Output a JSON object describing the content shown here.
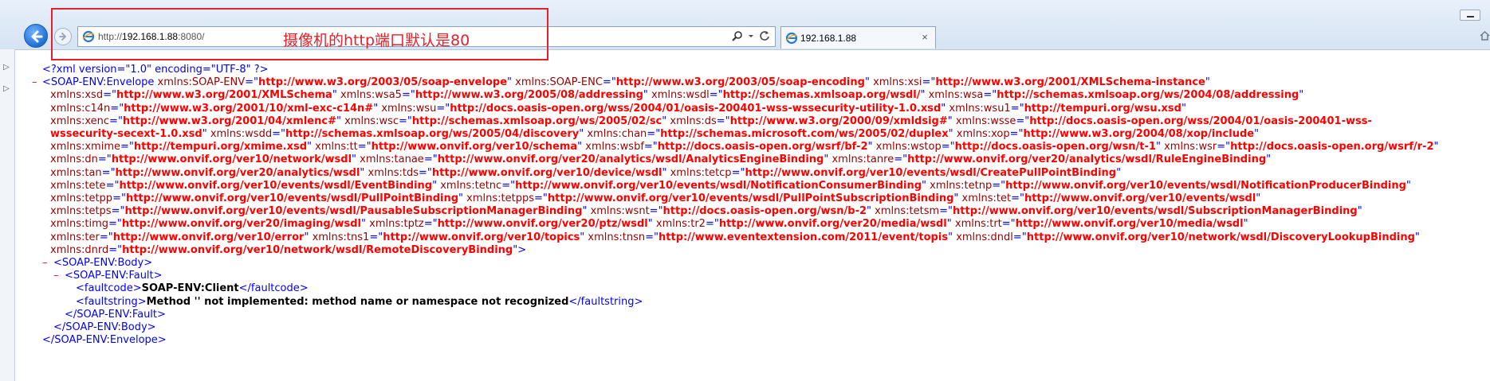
{
  "browser": {
    "url_prefix": "http://",
    "url_host": "192.168.1.88",
    "url_suffix": ":8080/",
    "tab_title": "192.168.1.88",
    "tab_close": "×"
  },
  "annotation": {
    "text": "摄像机的http端口默认是80",
    "color": "#e4202a"
  },
  "icons": {
    "back": "back-arrow-icon",
    "forward": "forward-arrow-icon",
    "page": "ie-page-icon",
    "search": "search-icon",
    "refresh": "refresh-icon"
  },
  "colors": {
    "tag": "#0000ff",
    "attr_name": "#990000",
    "attr_value": "#ff0000",
    "collapse_marker": "#e4202a"
  },
  "xml": {
    "declaration": "<?xml version=\"1.0\" encoding=\"UTF-8\" ?>",
    "collapse_marker": "–",
    "envelope_open": "<SOAP-ENV:Envelope",
    "namespace_lines": [
      [
        [
          "xmlns:SOAP-ENV",
          "http://www.w3.org/2003/05/soap-envelope"
        ],
        [
          "xmlns:SOAP-ENC",
          "http://www.w3.org/2003/05/soap-encoding"
        ],
        [
          "xmlns:xsi",
          "http://www.w3.org/2001/XMLSchema-instance"
        ]
      ],
      [
        [
          "xmlns:xsd",
          "http://www.w3.org/2001/XMLSchema"
        ],
        [
          "xmlns:wsa5",
          "http://www.w3.org/2005/08/addressing"
        ],
        [
          "xmlns:wsdl",
          "http://schemas.xmlsoap.org/wsdl/"
        ],
        [
          "xmlns:wsa",
          "http://schemas.xmlsoap.org/ws/2004/08/addressing"
        ]
      ],
      [
        [
          "xmlns:c14n",
          "http://www.w3.org/2001/10/xml-exc-c14n#"
        ],
        [
          "xmlns:wsu",
          "http://docs.oasis-open.org/wss/2004/01/oasis-200401-wss-wssecurity-utility-1.0.xsd"
        ],
        [
          "xmlns:wsu1",
          "http://tempuri.org/wsu.xsd"
        ]
      ],
      [
        [
          "xmlns:xenc",
          "http://www.w3.org/2001/04/xmlenc#"
        ],
        [
          "xmlns:wsc",
          "http://schemas.xmlsoap.org/ws/2005/02/sc"
        ],
        [
          "xmlns:ds",
          "http://www.w3.org/2000/09/xmldsig#"
        ],
        [
          "xmlns:wsse",
          "http://docs.oasis-open.org/wss/2004/01/oasis-200401-wss-"
        ]
      ],
      [
        [
          "",
          "wssecurity-secext-1.0.xsd"
        ],
        [
          "xmlns:wsdd",
          "http://schemas.xmlsoap.org/ws/2005/04/discovery"
        ],
        [
          "xmlns:chan",
          "http://schemas.microsoft.com/ws/2005/02/duplex"
        ],
        [
          "xmlns:xop",
          "http://www.w3.org/2004/08/xop/include"
        ]
      ],
      [
        [
          "xmlns:xmime",
          "http://tempuri.org/xmime.xsd"
        ],
        [
          "xmlns:tt",
          "http://www.onvif.org/ver10/schema"
        ],
        [
          "xmlns:wsbf",
          "http://docs.oasis-open.org/wsrf/bf-2"
        ],
        [
          "xmlns:wstop",
          "http://docs.oasis-open.org/wsn/t-1"
        ],
        [
          "xmlns:wsr",
          "http://docs.oasis-open.org/wsrf/r-2"
        ]
      ],
      [
        [
          "xmlns:dn",
          "http://www.onvif.org/ver10/network/wsdl"
        ],
        [
          "xmlns:tanae",
          "http://www.onvif.org/ver20/analytics/wsdl/AnalyticsEngineBinding"
        ],
        [
          "xmlns:tanre",
          "http://www.onvif.org/ver20/analytics/wsdl/RuleEngineBinding"
        ]
      ],
      [
        [
          "xmlns:tan",
          "http://www.onvif.org/ver20/analytics/wsdl"
        ],
        [
          "xmlns:tds",
          "http://www.onvif.org/ver10/device/wsdl"
        ],
        [
          "xmlns:tetcp",
          "http://www.onvif.org/ver10/events/wsdl/CreatePullPointBinding"
        ]
      ],
      [
        [
          "xmlns:tete",
          "http://www.onvif.org/ver10/events/wsdl/EventBinding"
        ],
        [
          "xmlns:tetnc",
          "http://www.onvif.org/ver10/events/wsdl/NotificationConsumerBinding"
        ],
        [
          "xmlns:tetnp",
          "http://www.onvif.org/ver10/events/wsdl/NotificationProducerBinding"
        ]
      ],
      [
        [
          "xmlns:tetpp",
          "http://www.onvif.org/ver10/events/wsdl/PullPointBinding"
        ],
        [
          "xmlns:tetpps",
          "http://www.onvif.org/ver10/events/wsdl/PullPointSubscriptionBinding"
        ],
        [
          "xmlns:tet",
          "http://www.onvif.org/ver10/events/wsdl"
        ]
      ],
      [
        [
          "xmlns:tetps",
          "http://www.onvif.org/ver10/events/wsdl/PausableSubscriptionManagerBinding"
        ],
        [
          "xmlns:wsnt",
          "http://docs.oasis-open.org/wsn/b-2"
        ],
        [
          "xmlns:tetsm",
          "http://www.onvif.org/ver10/events/wsdl/SubscriptionManagerBinding"
        ]
      ],
      [
        [
          "xmlns:timg",
          "http://www.onvif.org/ver20/imaging/wsdl"
        ],
        [
          "xmlns:tptz",
          "http://www.onvif.org/ver20/ptz/wsdl"
        ],
        [
          "xmlns:tr2",
          "http://www.onvif.org/ver20/media/wsdl"
        ],
        [
          "xmlns:trt",
          "http://www.onvif.org/ver10/media/wsdl"
        ]
      ],
      [
        [
          "xmlns:ter",
          "http://www.onvif.org/ver10/error"
        ],
        [
          "xmlns:tns1",
          "http://www.onvif.org/ver10/topics"
        ],
        [
          "xmlns:tnsn",
          "http://www.eventextension.com/2011/event/topis"
        ],
        [
          "xmlns:dndl",
          "http://www.onvif.org/ver10/network/wsdl/DiscoveryLookupBinding"
        ]
      ],
      [
        [
          "xmlns:dnrd",
          "http://www.onvif.org/ver10/network/wsdl/RemoteDiscoveryBinding"
        ]
      ]
    ],
    "envelope_open_end": ">",
    "body_open": "<SOAP-ENV:Body>",
    "fault_open": "<SOAP-ENV:Fault>",
    "faultcode_open": "<faultcode>",
    "faultcode_value": "SOAP-ENV:Client",
    "faultcode_close": "</faultcode>",
    "faultstring_open": "<faultstring>",
    "faultstring_value": "Method '' not implemented: method name or namespace not recognized",
    "faultstring_close": "</faultstring>",
    "fault_close": "</SOAP-ENV:Fault>",
    "body_close": "</SOAP-ENV:Body>",
    "envelope_close": "</SOAP-ENV:Envelope>"
  }
}
